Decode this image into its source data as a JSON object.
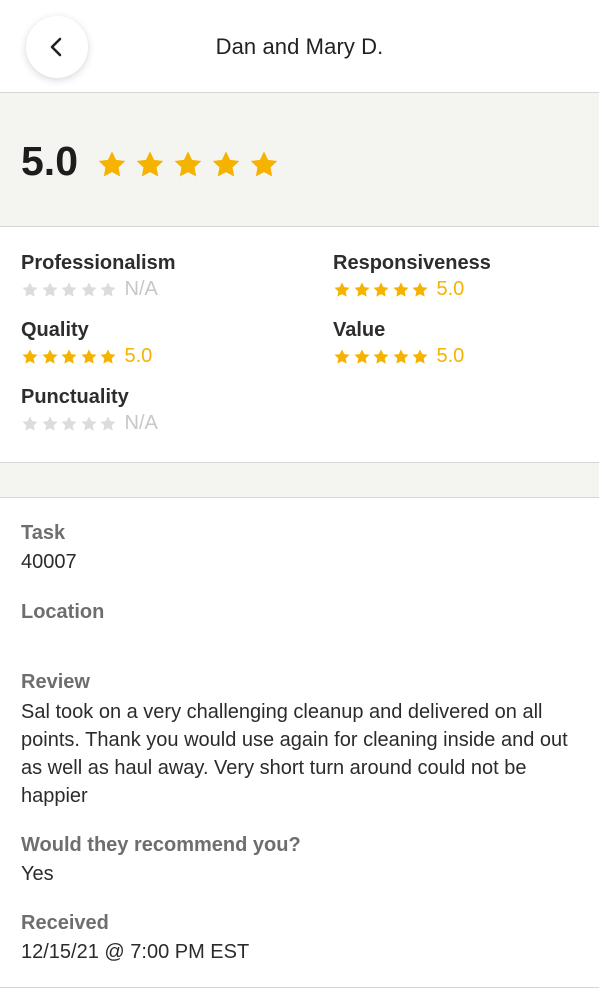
{
  "header": {
    "title": "Dan  and Mary D.",
    "back_icon": "chevron-left-icon"
  },
  "summary": {
    "score": "5.0",
    "stars": 5
  },
  "categories": [
    {
      "name": "Professionalism",
      "value": "N/A",
      "stars": 0
    },
    {
      "name": "Responsiveness",
      "value": "5.0",
      "stars": 5
    },
    {
      "name": "Quality",
      "value": "5.0",
      "stars": 5
    },
    {
      "name": "Value",
      "value": "5.0",
      "stars": 5
    },
    {
      "name": "Punctuality",
      "value": "N/A",
      "stars": 0
    }
  ],
  "details": {
    "task_label": "Task",
    "task_value": "40007",
    "location_label": "Location",
    "review_label": "Review",
    "review_text": "Sal took on a very challenging cleanup and delivered on all points. Thank you would use again for cleaning inside and out as well as haul away.  Very short turn around could not be happier",
    "recommend_label": "Would they recommend you?",
    "recommend_value": "Yes",
    "received_label": "Received",
    "received_value": "12/15/21 @ 7:00 PM EST"
  },
  "colors": {
    "star_filled": "#f5b300",
    "star_empty": "#dcdcda",
    "summary_bg": "#f4f4f0"
  }
}
